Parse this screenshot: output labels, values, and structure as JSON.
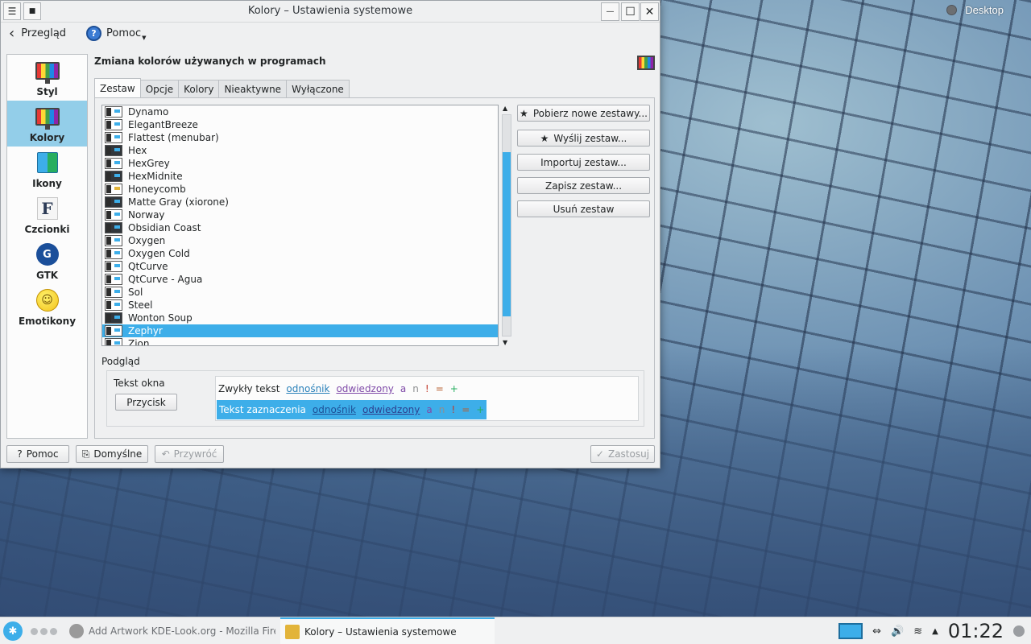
{
  "desktop": {
    "label": "Desktop"
  },
  "window": {
    "title": "Kolory – Ustawienia systemowe",
    "menu_icon": "☰",
    "pin_icon": "■",
    "minimize_icon": "—",
    "maximize_icon": "☐",
    "close_icon": "✕"
  },
  "toolbar": {
    "back_label": "Przegląd",
    "back_icon": "‹",
    "help_label": "Pomoc",
    "help_icon": "?"
  },
  "sidebar": {
    "items": [
      {
        "label": "Styl",
        "icon": "monitor-palette-icon"
      },
      {
        "label": "Kolory",
        "icon": "monitor-palette-icon",
        "active": true
      },
      {
        "label": "Ikony",
        "icon": "icons-icon"
      },
      {
        "label": "Czcionki",
        "icon": "font-icon",
        "glyph": "F"
      },
      {
        "label": "GTK",
        "icon": "gtk-icon",
        "glyph": "G"
      },
      {
        "label": "Emotikony",
        "icon": "smiley-icon",
        "glyph": "☺"
      }
    ]
  },
  "main": {
    "heading": "Zmiana kolorów używanych w programach",
    "tabs": [
      {
        "label": "Zestaw",
        "active": true
      },
      {
        "label": "Opcje"
      },
      {
        "label": "Kolory"
      },
      {
        "label": "Nieaktywne"
      },
      {
        "label": "Wyłączone"
      }
    ],
    "schemes": [
      "Dynamo",
      "ElegantBreeze",
      "Flattest (menubar)",
      "Hex",
      "HexGrey",
      "HexMidnite",
      "Honeycomb",
      "Matte Gray (xiorone)",
      "Norway",
      "Obsidian Coast",
      "Oxygen",
      "Oxygen Cold",
      "QtCurve",
      "QtCurve - Agua",
      "Sol",
      "Steel",
      "Wonton Soup",
      "Zephyr",
      "Zion"
    ],
    "selected_scheme": "Zephyr",
    "scroll_up": "▲",
    "scroll_down": "▼",
    "actions": [
      {
        "label": "Pobierz nowe zestawy...",
        "icon": "★"
      },
      {
        "label": "Wyślij zestaw...",
        "icon": "★"
      },
      {
        "label": "Importuj zestaw..."
      },
      {
        "label": "Zapisz zestaw..."
      },
      {
        "label": "Usuń zestaw"
      }
    ],
    "preview": {
      "label": "Podgląd",
      "window_text": "Tekst okna",
      "button_label": "Przycisk",
      "normal_text": "Zwykły tekst",
      "selection_text": "Tekst zaznaczenia",
      "link": "odnośnik",
      "visited": "odwiedzony",
      "active": "a",
      "inactive": "n",
      "negative": "!",
      "neutral": "=",
      "positive": "+"
    }
  },
  "bottom": {
    "help": "Pomoc",
    "help_icon": "?",
    "defaults": "Domyślne",
    "defaults_icon": "⎘",
    "reset": "Przywróć",
    "reset_icon": "↶",
    "apply": "Zastosuj",
    "apply_icon": "✓"
  },
  "taskbar": {
    "launcher_icon": "✱",
    "tasks": [
      {
        "label": "Add  Artwork KDE-Look.org - Mozilla Firefo",
        "active": false
      },
      {
        "label": "Kolory – Ustawienia systemowe",
        "active": true
      }
    ],
    "clock": "01:22",
    "tray_icons": [
      "screen-icon",
      "network-icon",
      "volume-icon",
      "wifi-icon",
      "expand-icon"
    ],
    "tray_glyphs": {
      "network": "⇔",
      "volume": "🔊",
      "wifi": "≋",
      "expand": "▲"
    }
  },
  "colors": {
    "accent": "#3daee9",
    "sidebar_active": "#93cee9",
    "link": "#2980b9",
    "visited": "#7f4aa8"
  }
}
